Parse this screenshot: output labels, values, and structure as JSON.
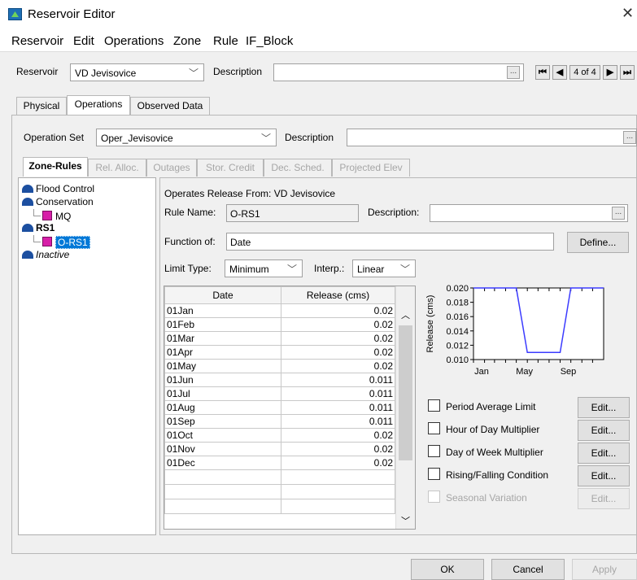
{
  "window": {
    "title": "Reservoir Editor",
    "close_glyph": "✕"
  },
  "menu": [
    "Reservoir",
    "Edit",
    "Operations",
    "Zone",
    "Rule",
    "IF_Block"
  ],
  "reservoir_bar": {
    "reservoir_label": "Reservoir",
    "reservoir_value": "VD Jevisovice",
    "description_label": "Description",
    "description_value": "",
    "ellipsis": "...",
    "record_counter": "4 of 4",
    "nav_first": "⏮",
    "nav_prev": "◀",
    "nav_next": "▶",
    "nav_last": "⏭"
  },
  "main_tabs": [
    {
      "label": "Physical",
      "active": false
    },
    {
      "label": "Operations",
      "active": true
    },
    {
      "label": "Observed Data",
      "active": false
    }
  ],
  "operation_set": {
    "label": "Operation Set",
    "value": "Oper_Jevisovice",
    "description_label": "Description",
    "description_value": ""
  },
  "sub_tabs": [
    {
      "label": "Zone-Rules",
      "active": true
    },
    {
      "label": "Rel. Alloc.",
      "active": false
    },
    {
      "label": "Outages",
      "active": false
    },
    {
      "label": "Stor. Credit",
      "active": false
    },
    {
      "label": "Dec. Sched.",
      "active": false
    },
    {
      "label": "Projected Elev",
      "active": false
    }
  ],
  "tree": [
    {
      "label": "Flood Control",
      "type": "zone"
    },
    {
      "label": "Conservation",
      "type": "zone"
    },
    {
      "label": "MQ",
      "type": "rule"
    },
    {
      "label": "RS1",
      "type": "zone"
    },
    {
      "label": "O-RS1",
      "type": "rule",
      "selected": true
    },
    {
      "label": "Inactive",
      "type": "zone"
    }
  ],
  "rule": {
    "operates_release_from": "Operates Release From: VD Jevisovice",
    "rule_name_label": "Rule Name:",
    "rule_name_value": "O-RS1",
    "description_label": "Description:",
    "description_value": "",
    "function_of_label": "Function of:",
    "function_of_value": "Date",
    "define_button": "Define...",
    "limit_type_label": "Limit Type:",
    "limit_type_value": "Minimum",
    "interp_label": "Interp.:",
    "interp_value": "Linear"
  },
  "table": {
    "headers": [
      "Date",
      "Release (cms)"
    ],
    "rows": [
      [
        "01Jan",
        "0.02"
      ],
      [
        "01Feb",
        "0.02"
      ],
      [
        "01Mar",
        "0.02"
      ],
      [
        "01Apr",
        "0.02"
      ],
      [
        "01May",
        "0.02"
      ],
      [
        "01Jun",
        "0.011"
      ],
      [
        "01Jul",
        "0.011"
      ],
      [
        "01Aug",
        "0.011"
      ],
      [
        "01Sep",
        "0.011"
      ],
      [
        "01Oct",
        "0.02"
      ],
      [
        "01Nov",
        "0.02"
      ],
      [
        "01Dec",
        "0.02"
      ]
    ],
    "empty_rows": 3
  },
  "chart_data": {
    "type": "line",
    "title": "",
    "xlabel": "",
    "ylabel": "Release (cms)",
    "x_tick_labels": [
      "Jan",
      "May",
      "Sep"
    ],
    "y_tick_labels": [
      "0.020",
      "0.018",
      "0.016",
      "0.014",
      "0.012",
      "0.010"
    ],
    "ylim": [
      0.01,
      0.02
    ],
    "xlim_days": [
      0,
      365
    ],
    "series": [
      {
        "x": [
          "01Jan",
          "01Feb",
          "01Mar",
          "01Apr",
          "01May",
          "01Jun",
          "01Jul",
          "01Aug",
          "01Sep",
          "01Oct",
          "01Nov",
          "01Dec"
        ],
        "values": [
          0.02,
          0.02,
          0.02,
          0.02,
          0.02,
          0.011,
          0.011,
          0.011,
          0.011,
          0.02,
          0.02,
          0.02
        ],
        "color": "#3b3bff"
      }
    ],
    "grid": false
  },
  "options": [
    {
      "label": "Period Average Limit",
      "checked": false,
      "enabled": true,
      "edit": "Edit..."
    },
    {
      "label": "Hour of Day Multiplier",
      "checked": false,
      "enabled": true,
      "edit": "Edit..."
    },
    {
      "label": "Day of Week Multiplier",
      "checked": false,
      "enabled": true,
      "edit": "Edit..."
    },
    {
      "label": "Rising/Falling Condition",
      "checked": false,
      "enabled": true,
      "edit": "Edit..."
    },
    {
      "label": "Seasonal Variation",
      "checked": false,
      "enabled": false,
      "edit": "Edit..."
    }
  ],
  "footer": {
    "ok": "OK",
    "cancel": "Cancel",
    "apply": "Apply"
  },
  "colors": {
    "selection": "#0078d7",
    "zone_icon": "#1c4fa0",
    "rule_icon": "#d71fa8",
    "series": "#3b3bff"
  }
}
